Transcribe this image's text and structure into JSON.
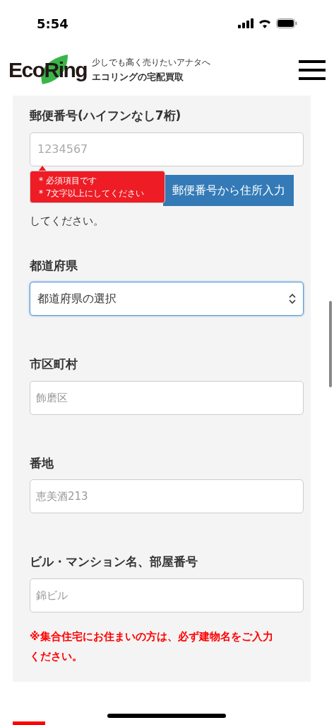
{
  "status_bar": {
    "time": "5:54"
  },
  "header": {
    "logo": "EcoRing",
    "tagline": "少しでも高く売りたいアナタへ",
    "service": "エコリングの宅配買取"
  },
  "postal": {
    "label": "郵便番号(ハイフンなし7桁)",
    "placeholder": "1234567",
    "errors": [
      "* 必須項目です",
      "* 7文字以上にしてください"
    ],
    "note_visible": "してください。",
    "button": "郵便番号から住所入力"
  },
  "prefecture": {
    "label": "都道府県",
    "value": "都道府県の選択",
    "focused": true
  },
  "fields": [
    {
      "label": "市区町村",
      "placeholder": "飾磨区"
    },
    {
      "label": "番地",
      "placeholder": "恵美酒213"
    },
    {
      "label": "ビル・マンション名、部屋番号",
      "placeholder": "錦ビル"
    }
  ],
  "warning": "※集合住宅にお住まいの方は、必ず建物名をご入力ください。"
}
